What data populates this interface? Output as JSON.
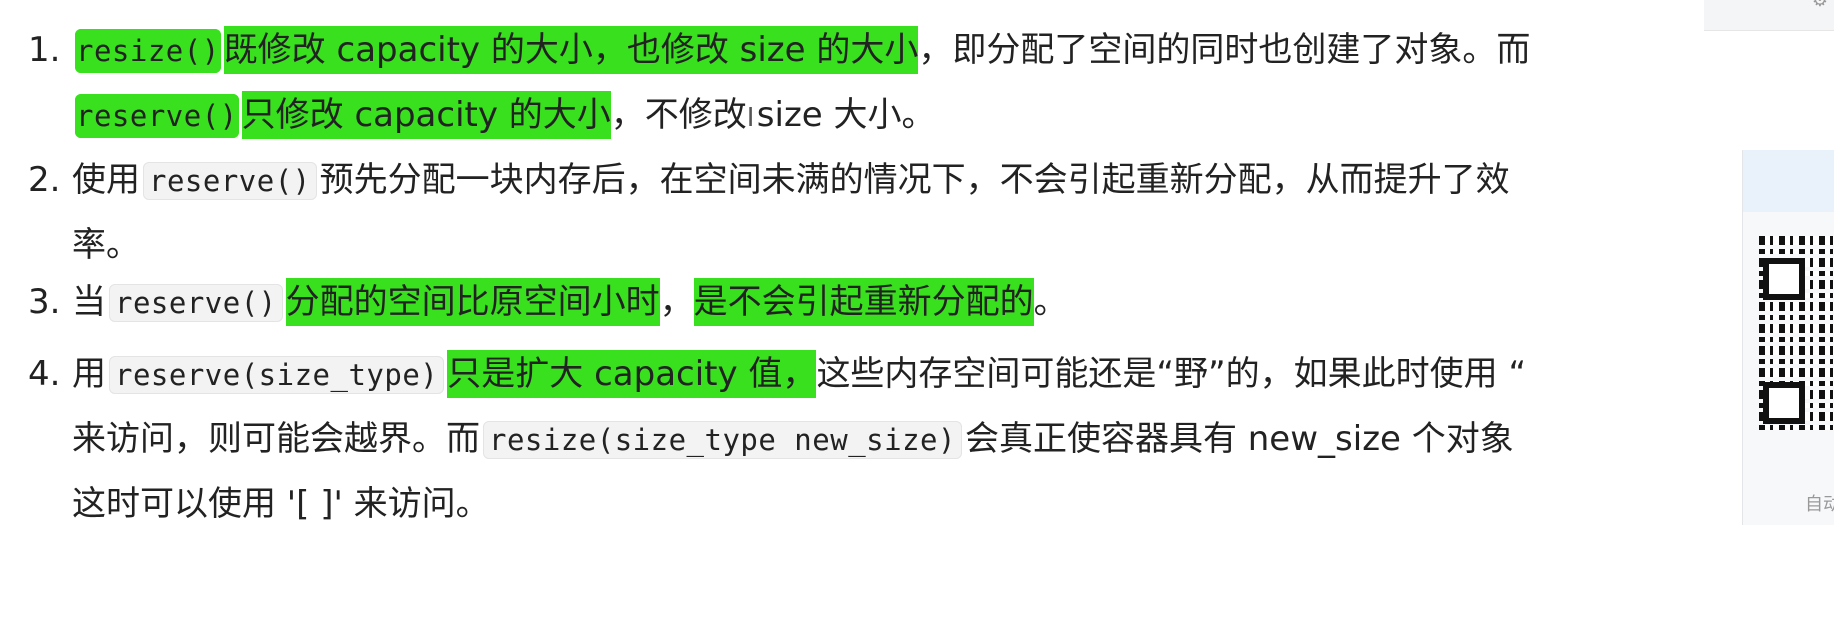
{
  "list": {
    "item1": {
      "number": "1.",
      "line1": {
        "code": "resize()",
        "hl": "既修改 capacity 的大小，也修改 size 的大小",
        "rest": "，即分配了空间的同时也创建了对象。而"
      },
      "line2": {
        "code": "reserve()",
        "hl": "只修改 capacity 的大小",
        "rest_a": "，不修改",
        "rest_b": "size 大小。"
      }
    },
    "item2": {
      "number": "2.",
      "pre": "使用",
      "code": "reserve()",
      "rest": "预先分配一块内存后，在空间未满的情况下，不会引起重新分配，从而提升了效",
      "line2": "率。"
    },
    "item3": {
      "number": "3.",
      "pre": "当",
      "code": "reserve()",
      "hl1": "分配的空间比原空间小时",
      "mid": "，",
      "hl2": "是不会引起重新分配的",
      "end": "。"
    },
    "item4": {
      "number": "4.",
      "line1": {
        "pre": "用",
        "code": "reserve(size_type)",
        "hl": "只是扩大 capacity 值，",
        "rest": "这些内存空间可能还是“野”的，如果此时使用 “"
      },
      "line2": {
        "pre": "来访问，则可能会越界。而",
        "code": "resize(size_type new_size)",
        "rest": "会真正使容器具有 new_size 个对象"
      },
      "line3": "这时可以使用 '[ ]' 来访问。"
    }
  },
  "side_panel": {
    "caption": "自动"
  },
  "colors": {
    "highlight": "#39e01e",
    "code_bg": "#f3f3f3"
  },
  "icons": {
    "text_cursor": "I-beam-icon",
    "qr": "qr-code-icon"
  }
}
